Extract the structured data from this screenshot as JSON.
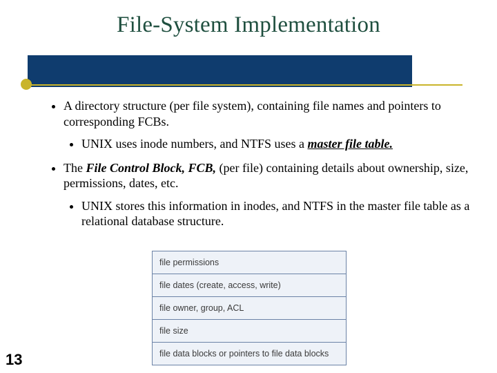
{
  "title": "File-System Implementation",
  "bullets": {
    "b1_pre": "A directory structure (per file system), containing file names and pointers to corresponding FCBs.",
    "b1a_pre": "UNIX uses inode numbers, and NTFS uses a ",
    "b1a_mft": "master file table.",
    "b2_pre": "The ",
    "b2_fcb": "File Control Block, FCB,",
    "b2_post": " (per file) containing details about ownership, size, permissions, dates, etc.",
    "b2a": "UNIX stores this information in inodes, and NTFS in the master file table as a relational database structure."
  },
  "fcb_rows": {
    "r0": "file permissions",
    "r1": "file dates (create, access, write)",
    "r2": "file owner, group, ACL",
    "r3": "file size",
    "r4": "file data blocks or pointers to file data blocks"
  },
  "page_number": "13"
}
